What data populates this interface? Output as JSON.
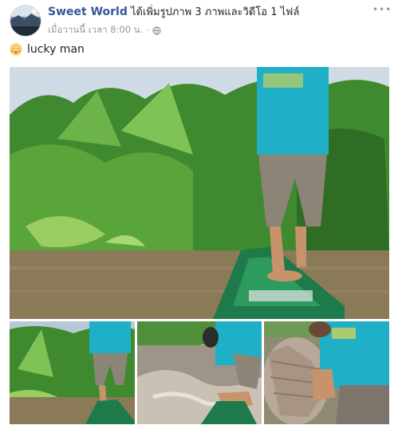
{
  "post": {
    "author": "Sweet World",
    "action_text": "ได้เพิ่มรูปภาพ 3 ภาพและวิดีโอ 1 ไฟล์",
    "timestamp": "เมื่อวานนี้ เวลา 8:00 น.",
    "separator": "·",
    "privacy_icon": "globe-icon",
    "more_icon": "ellipsis-icon",
    "message": "lucky man",
    "message_emoji": "flushed-face-emoji"
  },
  "media": {
    "count_photos": 3,
    "count_videos": 1,
    "items": [
      {
        "kind": "photo",
        "description_name": "main-photo-boat-river"
      },
      {
        "kind": "photo",
        "description_name": "thumb-man-standing-on-boat"
      },
      {
        "kind": "photo",
        "description_name": "thumb-man-kneeling-rapids"
      },
      {
        "kind": "video",
        "description_name": "thumb-man-holding-fish"
      }
    ]
  },
  "colors": {
    "author_link": "#365899",
    "meta_gray": "#90949c",
    "text": "#1d2129",
    "water": "#8a7a58",
    "shirt": "#1fb0c8",
    "boat": "#1e7a4a",
    "foliage": "#3f8a2e"
  }
}
